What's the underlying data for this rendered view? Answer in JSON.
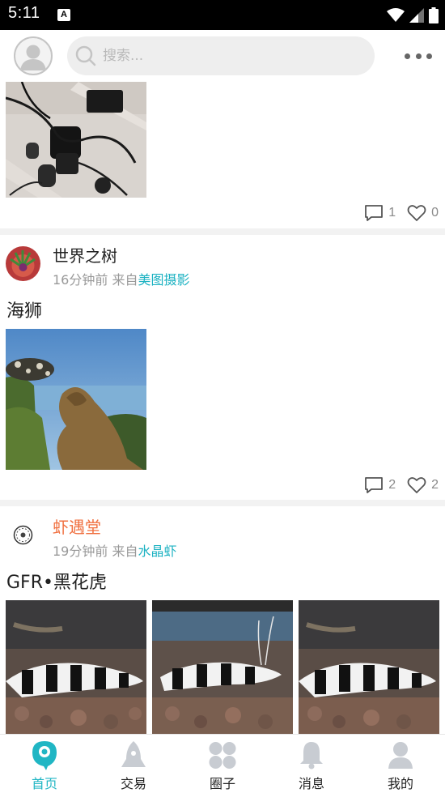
{
  "status_bar": {
    "time": "5:11",
    "notification_glyph": "A",
    "icons": [
      "wifi-icon",
      "signal-icon",
      "battery-icon"
    ]
  },
  "header": {
    "search_placeholder": "搜索...",
    "icons": [
      "avatar-icon",
      "search-icon",
      "more-icon"
    ]
  },
  "feed": {
    "partial_post": {
      "comments": "1",
      "likes": "0"
    },
    "posts": [
      {
        "author": "世界之树",
        "time": "16分钟前",
        "from_label": "来自",
        "circle": "美图摄影",
        "title": "海狮",
        "comments": "2",
        "likes": "2"
      },
      {
        "author": "虾遇堂",
        "time": "19分钟前",
        "from_label": "来自",
        "circle": "水晶虾",
        "title": "GFR•黑花虎"
      }
    ]
  },
  "bottom_nav": {
    "items": [
      {
        "label": "首页",
        "icon": "home-icon",
        "active": true
      },
      {
        "label": "交易",
        "icon": "rocket-icon",
        "active": false
      },
      {
        "label": "圈子",
        "icon": "circles-icon",
        "active": false
      },
      {
        "label": "消息",
        "icon": "bell-icon",
        "active": false
      },
      {
        "label": "我的",
        "icon": "person-icon",
        "active": false
      }
    ]
  },
  "colors": {
    "accent": "#20b6c4",
    "author_highlight": "#f07040",
    "status_bar": "#000000",
    "divider": "#f2f2f2"
  }
}
